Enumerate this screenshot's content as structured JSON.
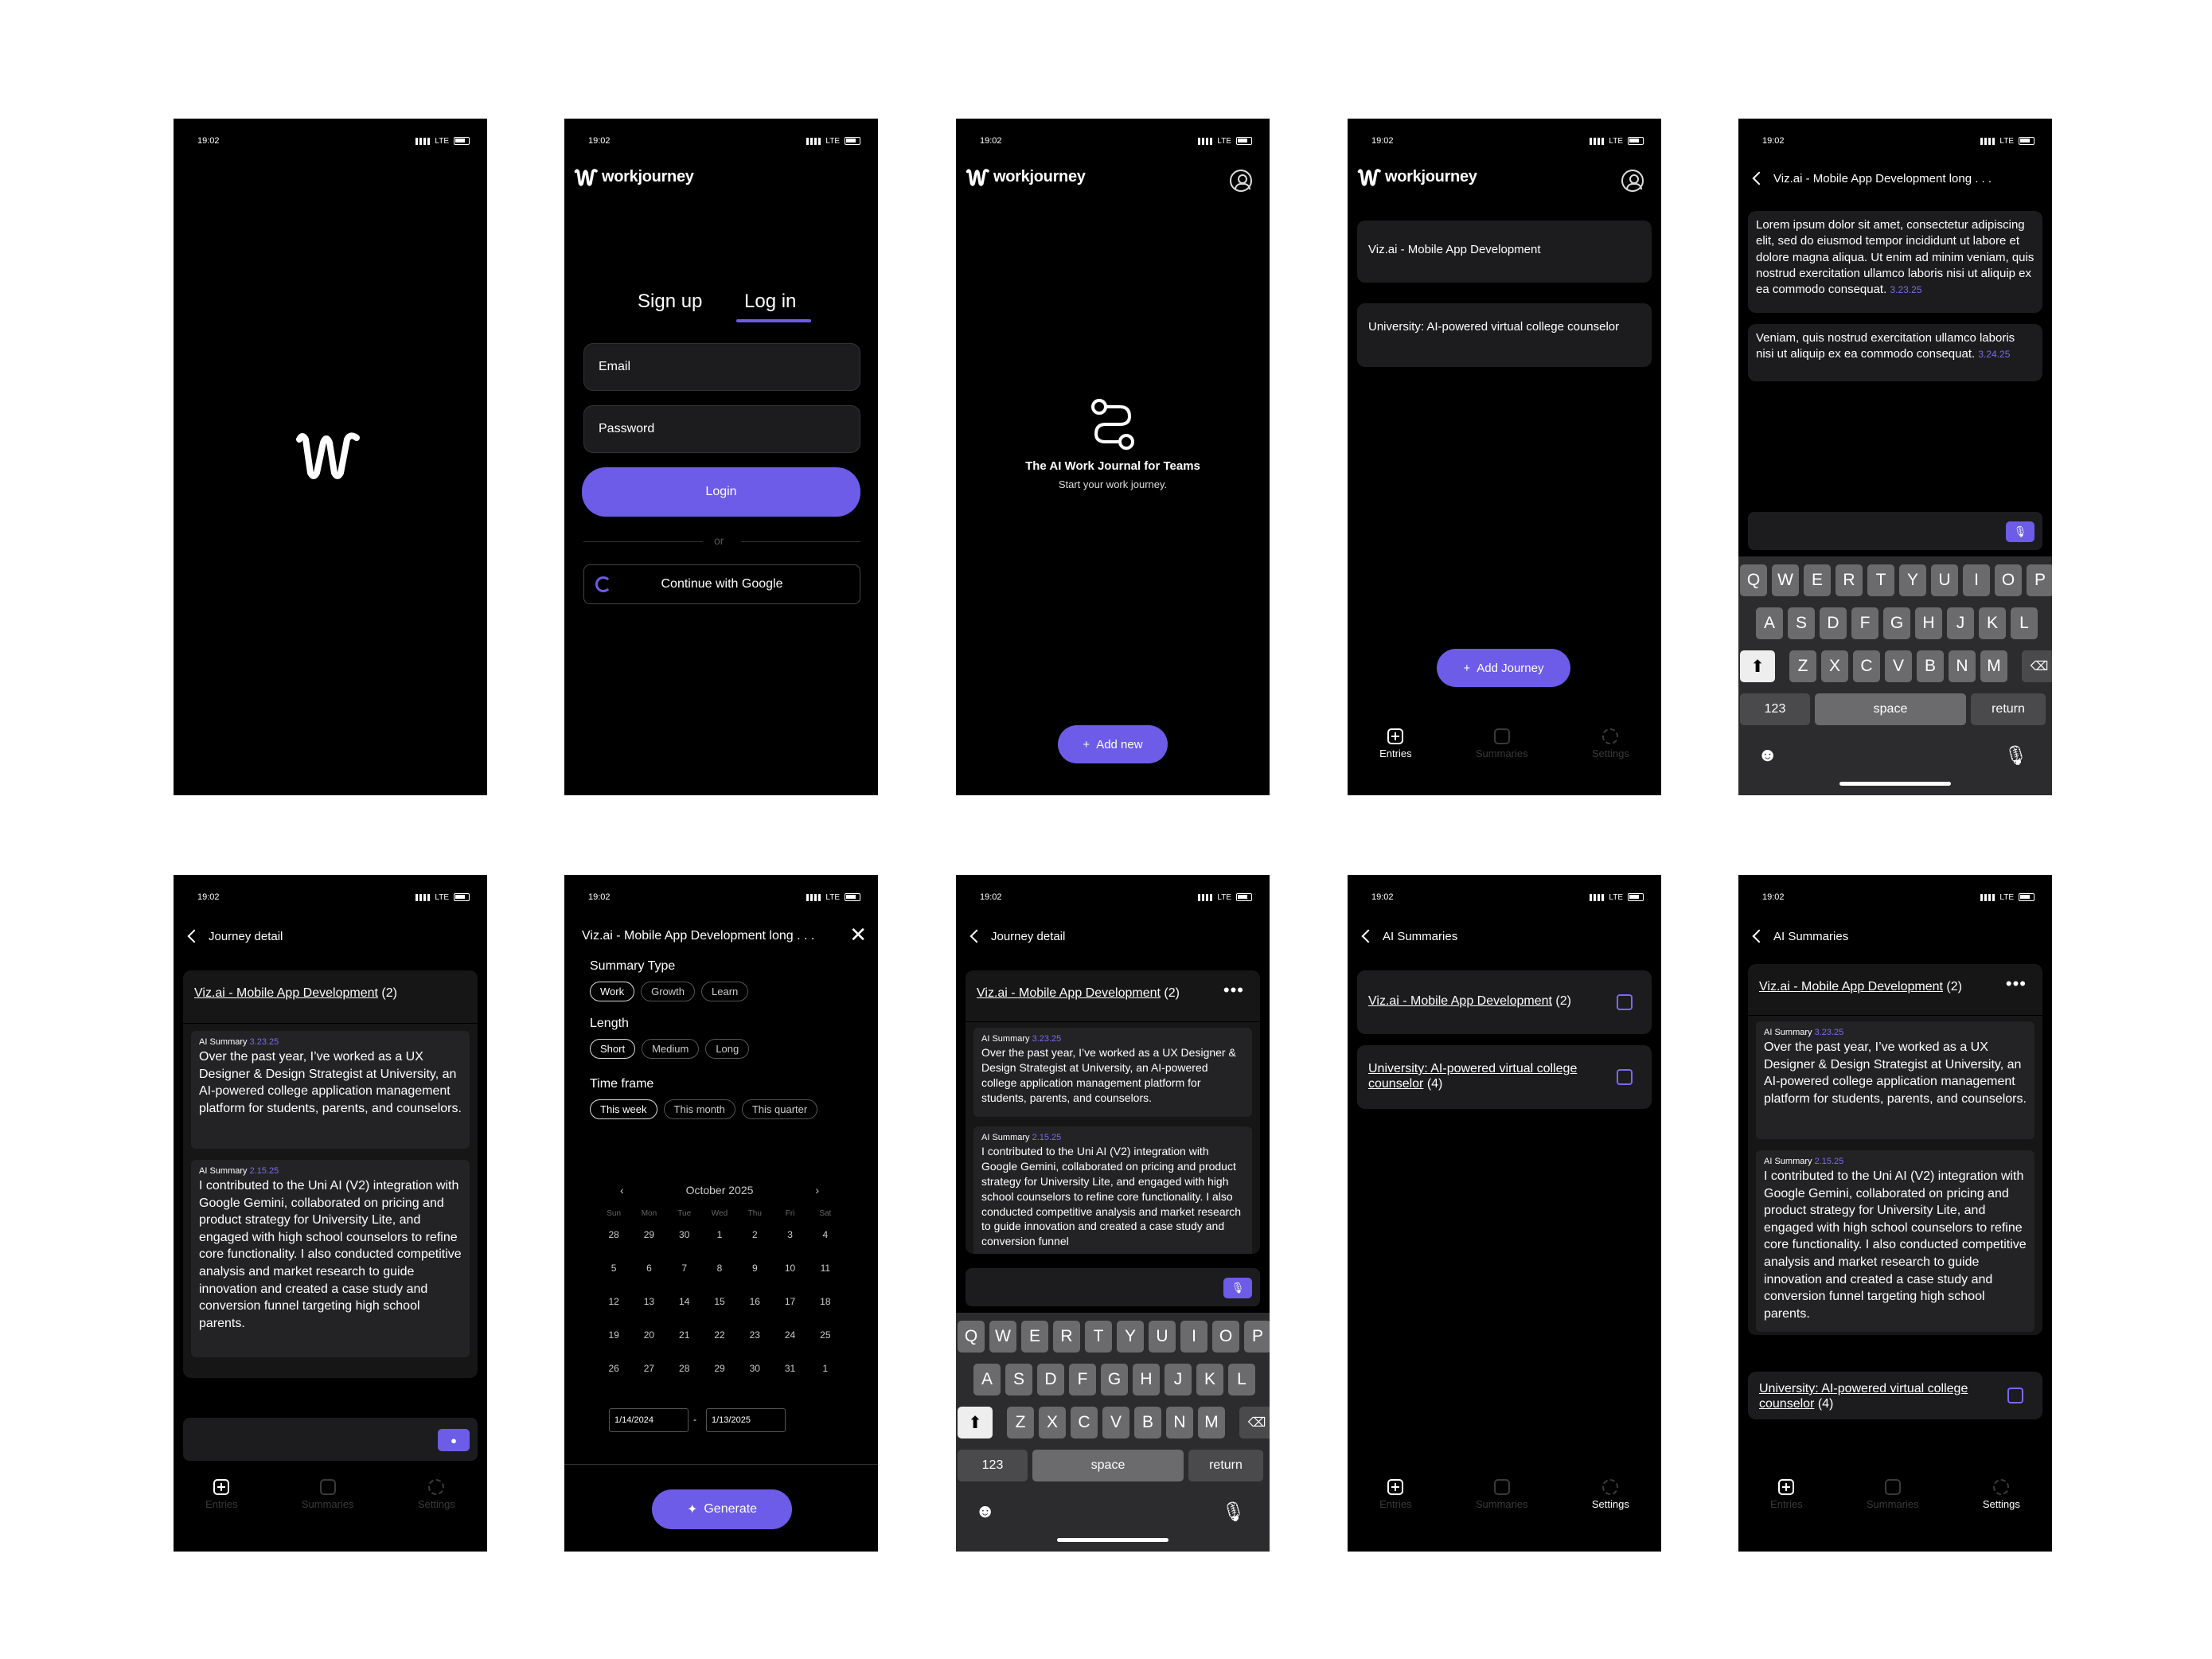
{
  "status": {
    "time": "19:02",
    "net": "LTE"
  },
  "brand": {
    "name": "workjourney"
  },
  "login": {
    "tab_signup": "Sign up",
    "tab_login": "Log in",
    "email": "Email",
    "password": "Password",
    "login_btn": "Login",
    "or": "or",
    "google_btn": "Continue with Google"
  },
  "empty": {
    "title": "The AI Work Journal for Teams",
    "subtitle": "Start your work journey.",
    "add_new": "Add new"
  },
  "journeys": {
    "items": [
      "Viz.ai - Mobile App Development",
      "University: AI-powered virtual college counselor"
    ],
    "add_btn": "Add Journey"
  },
  "tabs": {
    "entries": "Entries",
    "summaries": "Summaries",
    "settings": "Settings"
  },
  "entry": {
    "header": "Viz.ai - Mobile App Development long . . .",
    "note1": "Lorem ipsum dolor sit amet, consectetur adipiscing elit, sed do eiusmod tempor incididunt ut labore et dolore magna aliqua. Ut enim ad minim veniam, quis nostrud exercitation ullamco laboris nisi ut aliquip ex ea commodo consequat.",
    "date1": "3.23.25",
    "note2": "Veniam, quis nostrud exercitation ullamco laboris nisi ut aliquip ex ea commodo consequat.",
    "date2": "3.24.25"
  },
  "keyboard": {
    "row1": [
      "Q",
      "W",
      "E",
      "R",
      "T",
      "Y",
      "U",
      "I",
      "O",
      "P"
    ],
    "row2": [
      "A",
      "S",
      "D",
      "F",
      "G",
      "H",
      "J",
      "K",
      "L"
    ],
    "row3": [
      "Z",
      "X",
      "C",
      "V",
      "B",
      "N",
      "M"
    ],
    "k123": "123",
    "space": "space",
    "ret": "return"
  },
  "detail": {
    "header": "Journey detail",
    "journey": "Viz.ai - Mobile App Development",
    "count": "(2)",
    "label": "AI Summary",
    "d1": "3.23.25",
    "s1": "Over the past year, I’ve worked as a UX Designer & Design Strategist at University, an AI-powered college application management platform for students, parents, and counselors.",
    "d2": "2.15.25",
    "s2": "I contributed to the Uni AI (V2) integration with Google Gemini, collaborated on pricing and product strategy for University Lite, and engaged with high school counselors to refine core functionality. I also conducted competitive analysis and market research to guide innovation and created a case study and conversion funnel targeting high school parents.",
    "s2_cut": "I contributed to the Uni AI (V2) integration with Google Gemini, collaborated on pricing and product strategy for University Lite, and engaged with high school counselors to refine core functionality. I also conducted competitive analysis and market research to guide innovation and created a case study and conversion funnel"
  },
  "gen": {
    "header": "Viz.ai - Mobile App Development long . . .",
    "type": "Summary Type",
    "types": [
      "Work",
      "Growth",
      "Learn"
    ],
    "length": "Length",
    "lengths": [
      "Short",
      "Medium",
      "Long"
    ],
    "timeframe": "Time frame",
    "frames": [
      "This week",
      "This month",
      "This quarter"
    ],
    "month": "October 2025",
    "weekdays": [
      "Sun",
      "Mon",
      "Tue",
      "Wed",
      "Thu",
      "Fri",
      "Sat"
    ],
    "days": [
      "28",
      "29",
      "30",
      "1",
      "2",
      "3",
      "4",
      "5",
      "6",
      "7",
      "8",
      "9",
      "10",
      "11",
      "12",
      "13",
      "14",
      "15",
      "16",
      "17",
      "18",
      "19",
      "20",
      "21",
      "22",
      "23",
      "24",
      "25",
      "26",
      "27",
      "28",
      "29",
      "30",
      "31",
      "1"
    ],
    "from": "1/14/2024",
    "to": "1/13/2025",
    "dash": "-",
    "btn": "Generate"
  },
  "summaries": {
    "header": "AI Summaries",
    "j1": "Viz.ai - Mobile App Development",
    "c1": "(2)",
    "j2": "University: AI-powered virtual college counselor",
    "c2": "(4)"
  }
}
